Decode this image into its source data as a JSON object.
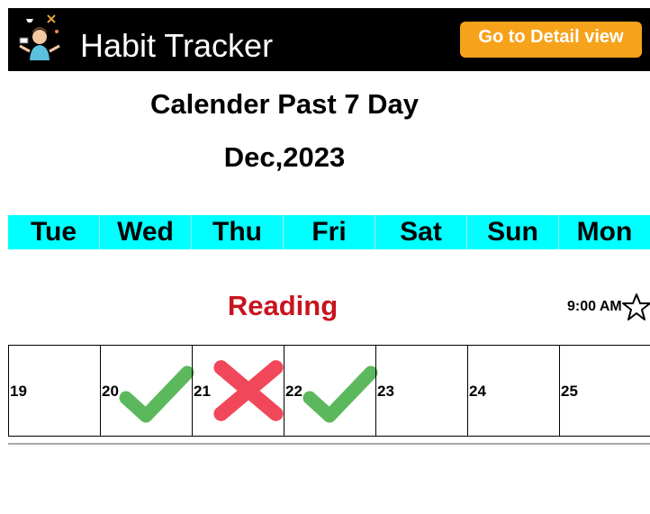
{
  "header": {
    "app_title": "Habit Tracker",
    "detail_button": "Go to Detail view",
    "logo_icon": "juggler-person-icon"
  },
  "calendar": {
    "title": "Calender Past 7 Day",
    "month": "Dec,2023",
    "days": [
      "Tue",
      "Wed",
      "Thu",
      "Fri",
      "Sat",
      "Sun",
      "Mon"
    ]
  },
  "habit": {
    "name": "Reading",
    "time": "9:00 AM",
    "favorite_icon": "star-outline-icon",
    "dates": [
      {
        "day": "19",
        "status": "none"
      },
      {
        "day": "20",
        "status": "done"
      },
      {
        "day": "21",
        "status": "missed"
      },
      {
        "day": "22",
        "status": "done"
      },
      {
        "day": "23",
        "status": "none"
      },
      {
        "day": "24",
        "status": "none"
      },
      {
        "day": "25",
        "status": "none"
      }
    ]
  },
  "colors": {
    "header_bg": "#000000",
    "button_bg": "#f7a21b",
    "day_bar_bg": "#00ffff",
    "habit_name": "#c8141e",
    "done": "#5cb85c",
    "missed": "#f0485a"
  }
}
